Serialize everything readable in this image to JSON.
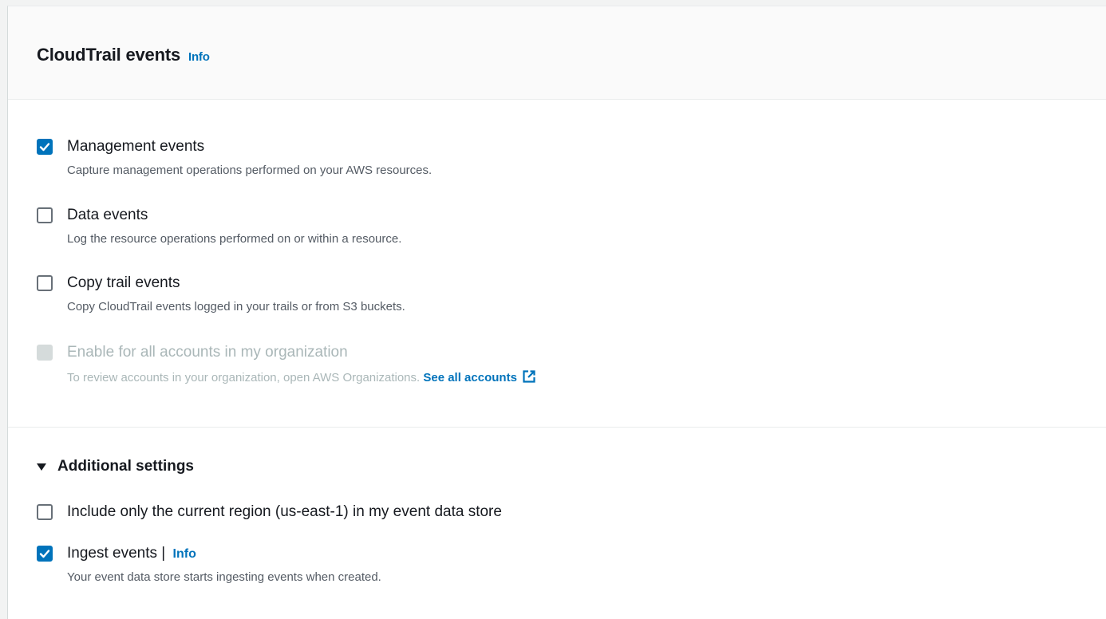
{
  "section": {
    "title": "CloudTrail events",
    "info_label": "Info"
  },
  "event_options": [
    {
      "label": "Management events",
      "description": "Capture management operations performed on your AWS resources.",
      "checked": true
    },
    {
      "label": "Data events",
      "description": "Log the resource operations performed on or within a resource.",
      "checked": false
    },
    {
      "label": "Copy trail events",
      "description": "Copy CloudTrail events logged in your trails or from S3 buckets.",
      "checked": false
    },
    {
      "label": "Enable for all accounts in my organization",
      "description": "To review accounts in your organization, open AWS Organizations.",
      "link_label": "See all accounts",
      "checked": false,
      "disabled": true
    }
  ],
  "additional_settings": {
    "label": "Additional settings",
    "expanded": true,
    "options": [
      {
        "label": "Include only the current region (us-east-1) in my event data store",
        "checked": false
      },
      {
        "label": "Ingest events |",
        "info_label": "Info",
        "description": "Your event data store starts ingesting events when created.",
        "checked": true
      }
    ]
  },
  "colors": {
    "accent": "#0073bb",
    "text": "#16191f",
    "muted": "#545b64",
    "disabled": "#aab7b8"
  }
}
